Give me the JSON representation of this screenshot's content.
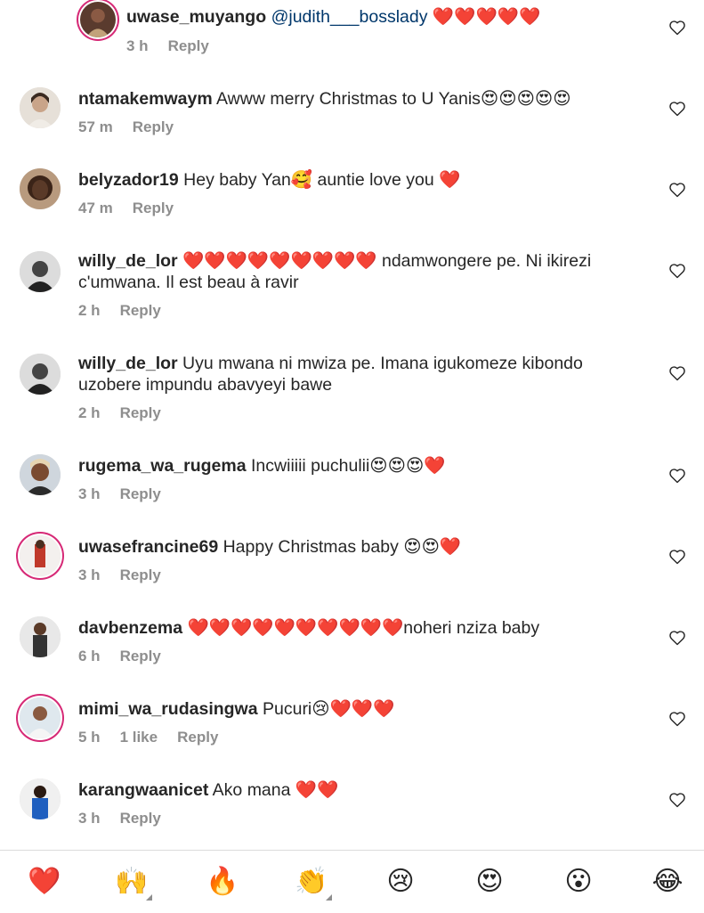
{
  "comments": [
    {
      "id": "c0",
      "username": "uwase_muyango",
      "mention": "@judith___bosslady",
      "text": " ❤️❤️❤️❤️❤️",
      "time": "3 h",
      "likes": "",
      "reply": "Reply",
      "ring": true
    },
    {
      "id": "c1",
      "username": "ntamakemwaym",
      "text": " Awww merry Christmas to U Yanis😍😍😍😍😍",
      "time": "57 m",
      "reply": "Reply"
    },
    {
      "id": "c2",
      "username": "belyzador19",
      "text": " Hey baby Yan🥰 auntie love you ❤️",
      "time": "47 m",
      "reply": "Reply"
    },
    {
      "id": "c3",
      "username": "willy_de_lor",
      "text": " ❤️❤️❤️❤️❤️❤️❤️❤️❤️ ndamwongere pe.  Ni ikirezi c'umwana. Il est beau à ravir",
      "time": "2 h",
      "reply": "Reply"
    },
    {
      "id": "c4",
      "username": "willy_de_lor",
      "text": " Uyu mwana ni mwiza pe. Imana igukomeze kibondo uzobere impundu abavyeyi bawe",
      "time": "2 h",
      "reply": "Reply"
    },
    {
      "id": "c5",
      "username": "rugema_wa_rugema",
      "text": " Incwiiiii puchulii😍😍😍❤️",
      "time": "3 h",
      "reply": "Reply"
    },
    {
      "id": "c6",
      "username": "uwasefrancine69",
      "text": " Happy Christmas baby 😍😍❤️",
      "time": "3 h",
      "reply": "Reply",
      "ring": true
    },
    {
      "id": "c7",
      "username": "davbenzema",
      "text": " ❤️❤️❤️❤️❤️❤️❤️❤️❤️❤️noheri nziza baby",
      "time": "6 h",
      "reply": "Reply"
    },
    {
      "id": "c8",
      "username": "mimi_wa_rudasingwa",
      "text": " Pucuri😢❤️❤️❤️",
      "time": "5 h",
      "likes": "1 like",
      "reply": "Reply",
      "ring": true
    },
    {
      "id": "c9",
      "username": "karangwaanicet",
      "text": " Ako mana ❤️❤️",
      "time": "3 h",
      "reply": "Reply"
    }
  ],
  "emoji_bar": [
    {
      "glyph": "❤️",
      "name": "red-heart"
    },
    {
      "glyph": "🙌",
      "name": "raising-hands"
    },
    {
      "glyph": "🔥",
      "name": "fire"
    },
    {
      "glyph": "👏",
      "name": "clapping-hands"
    },
    {
      "glyph": "😢",
      "name": "crying-face"
    },
    {
      "glyph": "😍",
      "name": "heart-eyes"
    },
    {
      "glyph": "😮",
      "name": "surprised-face"
    },
    {
      "glyph": "😂",
      "name": "tears-of-joy"
    }
  ],
  "colors": {
    "like_icon": "#262626",
    "meta": "#8e8e8e",
    "mention": "#00376b",
    "story_ring": "#d62976"
  }
}
